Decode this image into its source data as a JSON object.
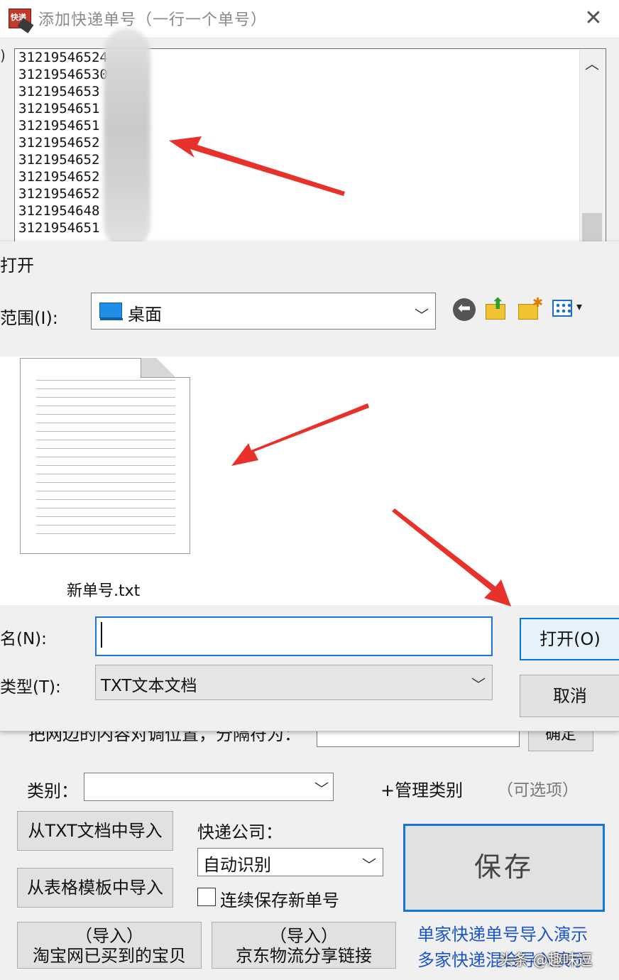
{
  "back_dialog": {
    "title": "添加快递单号（一行一个单号）",
    "icon_text": "快递",
    "close_glyph": "✕",
    "left_edge_fragment": ")",
    "numbers": [
      "31219546524",
      "31219546530",
      "3121954653",
      "3121954651",
      "3121954651",
      "3121954652",
      "3121954652",
      "3121954652",
      "3121954652",
      "3121954648",
      "3121954651"
    ],
    "scroll_up_glyph": "︿",
    "align_label": "把网边的内容对调位置，分隔符为：",
    "confirm_label": "确定",
    "category_label": "类别：",
    "manage_category": "+管理类别",
    "optional_hint": "（可选项）",
    "import_txt": "从TXT文档中导入",
    "import_template": "从表格模板中导入",
    "import_taobao_line1": "（导入）",
    "import_taobao_line2": "淘宝网已买到的宝贝",
    "import_jd_line1": "（导入）",
    "import_jd_line2": "京东物流分享链接",
    "courier_label": "快递公司：",
    "courier_value": "自动识别",
    "continuous_save": "连续保存新单号",
    "save_label": "保存",
    "demo_link_1": "单家快递单号导入演示",
    "demo_link_2": "多家快递混合导入演示",
    "watermark": "头条 @趣味逗",
    "dropdown_glyph": "﹀"
  },
  "open_dialog": {
    "title": "打开",
    "range_label": "范围(I):",
    "range_value": "桌面",
    "back_glyph": "⬅",
    "up_glyph": "⬆",
    "new_folder_glyph": "✱",
    "view_caret": "▾",
    "file_name": "新单号.txt",
    "filename_label": "名(N):",
    "filename_value": "",
    "filetype_label": "类型(T):",
    "filetype_value": "TXT文本文档",
    "open_label": "打开(O)",
    "cancel_label": "取消"
  },
  "colors": {
    "accent_blue": "#1a74d6",
    "link_blue": "#1a56c9",
    "annotation_red": "#e8312a"
  },
  "icons": [
    "app-icon",
    "close-icon",
    "desktop-icon",
    "back-arrow-icon",
    "up-folder-icon",
    "new-folder-icon",
    "view-menu-icon",
    "text-file-icon"
  ]
}
